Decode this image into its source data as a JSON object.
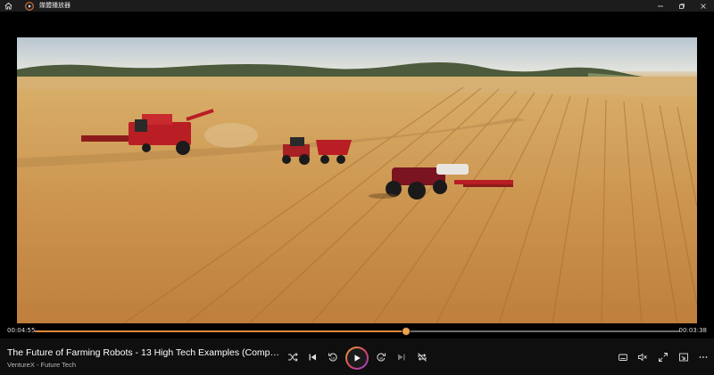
{
  "app": {
    "title": "媒體播放器"
  },
  "playback": {
    "current_time": "00:04:55",
    "remaining_time": "00:03:38",
    "progress_percent": 57.5
  },
  "media": {
    "title": "The Future of Farming Robots - 13 High Tech Examples (Comp…",
    "subtitle": "VentureX - Future Tech"
  },
  "colors": {
    "accent": "#e08a3c",
    "background": "#000000",
    "titlebar": "#1c1c1c",
    "controlbar": "#0f0f0f"
  },
  "icons": {
    "titlebar": [
      "home-icon",
      "media-player-app-icon",
      "minimize-icon",
      "maximize-icon",
      "close-icon"
    ],
    "transport": [
      "shuffle-icon",
      "previous-icon",
      "rewind-10-icon",
      "play-icon",
      "forward-30-icon",
      "next-icon",
      "repeat-icon"
    ],
    "right": [
      "captions-icon",
      "volume-mute-icon",
      "fullscreen-icon",
      "mini-player-icon",
      "more-options-icon"
    ]
  }
}
